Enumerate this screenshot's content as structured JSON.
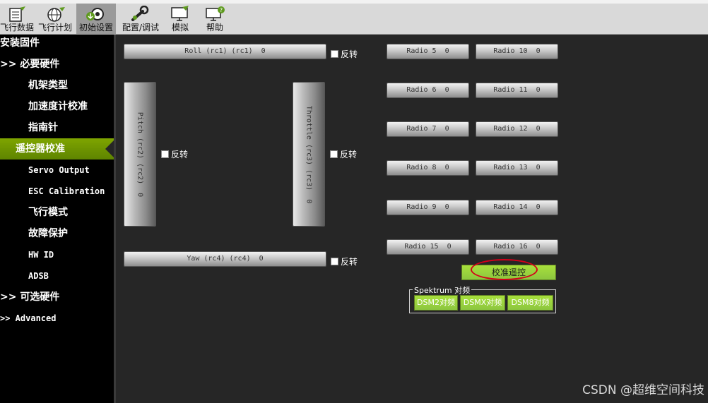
{
  "toolbar": {
    "items": [
      {
        "label": "飞行数据",
        "icon": "flight-data-icon"
      },
      {
        "label": "飞行计划",
        "icon": "globe-icon"
      },
      {
        "label": "初始设置",
        "icon": "gear-download-icon",
        "active": true
      },
      {
        "label": "配置/调试",
        "icon": "wrench-icon"
      },
      {
        "label": "模拟",
        "icon": "monitor-plane-icon"
      },
      {
        "label": "帮助",
        "icon": "help-monitor-icon"
      }
    ]
  },
  "sidebar": {
    "items": [
      {
        "label": "安装固件"
      },
      {
        "label": ">> 必要硬件"
      },
      {
        "label": "机架类型"
      },
      {
        "label": "加速度计校准"
      },
      {
        "label": "指南针"
      },
      {
        "label": "遥控器校准",
        "active": true
      },
      {
        "label": "Servo Output"
      },
      {
        "label": "ESC Calibration"
      },
      {
        "label": "飞行模式"
      },
      {
        "label": "故障保护"
      },
      {
        "label": "HW ID"
      },
      {
        "label": "ADSB"
      },
      {
        "label": ">> 可选硬件"
      },
      {
        "label": ">> Advanced"
      }
    ]
  },
  "channels": {
    "roll": "Roll (rc1) (rc1)  0",
    "pitch": "Pitch (rc2) (rc2)  0",
    "throttle": "Throttle (rc3) (rc3)  0",
    "yaw": "Yaw (rc4) (rc4)  0",
    "reverse_label": "反转"
  },
  "radios": [
    {
      "label": "Radio 5  0"
    },
    {
      "label": "Radio 10  0"
    },
    {
      "label": "Radio 6  0"
    },
    {
      "label": "Radio 11  0"
    },
    {
      "label": "Radio 7  0"
    },
    {
      "label": "Radio 12  0"
    },
    {
      "label": "Radio 8  0"
    },
    {
      "label": "Radio 13  0"
    },
    {
      "label": "Radio 9  0"
    },
    {
      "label": "Radio 14  0"
    },
    {
      "label": "Radio 15  0"
    },
    {
      "label": "Radio 16  0"
    }
  ],
  "calibrate_button": "校准遥控",
  "spektrum": {
    "title": "Spektrum 对频",
    "buttons": [
      "DSM2对频",
      "DSMX对频",
      "DSM8对频"
    ]
  },
  "watermark": "CSDN @超维空间科技",
  "colors": {
    "accent_green": "#8cc63f",
    "sidebar_active": "#7fa500",
    "annotation_red": "#d3001a",
    "background": "#262626"
  }
}
